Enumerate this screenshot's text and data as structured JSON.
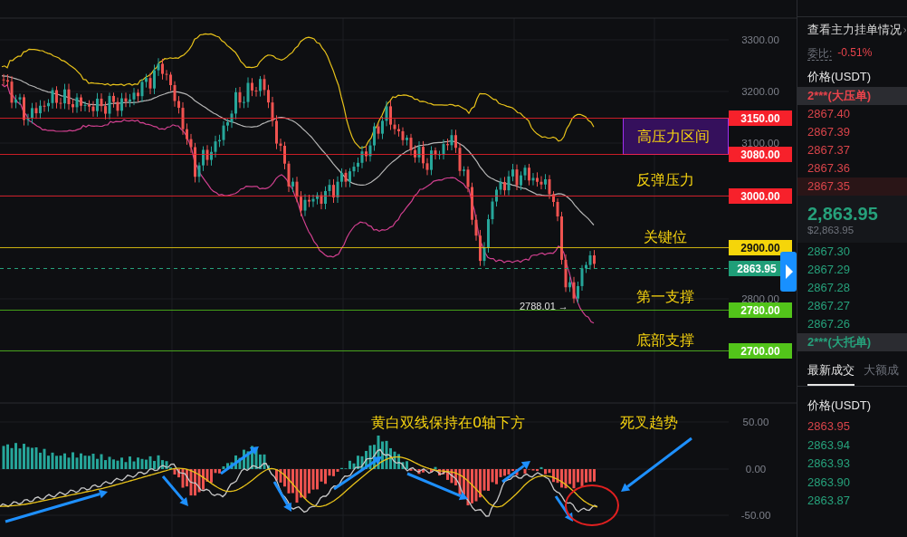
{
  "price_chart": {
    "axis_labels": [
      "3300.00",
      "3200.00",
      "3100.00",
      "2800.00"
    ],
    "level_lines": [
      {
        "price": "3150.00",
        "color": "#f7212b"
      },
      {
        "price": "3080.00",
        "color": "#f7212b"
      },
      {
        "price": "3000.00",
        "color": "#f7212b"
      },
      {
        "price": "2900.00",
        "color": "#f5d50a"
      },
      {
        "price": "2780.00",
        "color": "#52c41a"
      },
      {
        "price": "2700.00",
        "color": "#52c41a"
      }
    ],
    "zone": {
      "label": "高压力区间"
    },
    "annotations": [
      "反弹压力",
      "关键位",
      "第一支撑",
      "底部支撑"
    ],
    "current_price": "2863.95",
    "low_marker": "2788.01 →"
  },
  "macd": {
    "axis_labels": [
      "50.00",
      "0.00",
      "-50.00"
    ],
    "annotations": [
      "黄白双线保持在0轴下方",
      "死叉趋势"
    ]
  },
  "order_book": {
    "link": "查看主力挂单情况",
    "ratio_label": "委比:",
    "ratio_value": "-0.51%",
    "price_header": "价格(USDT)",
    "ask_banner": "2***(大压单)",
    "asks": [
      {
        "price": "2867.40",
        "highlighted": false
      },
      {
        "price": "2867.39",
        "highlighted": false
      },
      {
        "price": "2867.37",
        "highlighted": false
      },
      {
        "price": "2867.36",
        "highlighted": false
      },
      {
        "price": "2867.35",
        "highlighted": true
      }
    ],
    "last_price": "2,863.95",
    "last_price_usd": "$2,863.95",
    "bids": [
      "2867.30",
      "2867.29",
      "2867.28",
      "2867.27",
      "2867.26"
    ],
    "bid_banner": "2***(大托单)"
  },
  "trades": {
    "tabs": [
      {
        "label": "最新成交",
        "selected": true
      },
      {
        "label": "大额成",
        "selected": false
      }
    ],
    "price_header": "价格(USDT)",
    "rows": [
      {
        "price": "2863.95",
        "color": "#d9444a"
      },
      {
        "price": "2863.94",
        "color": "#26a17b"
      },
      {
        "price": "2863.93",
        "color": "#26a17b"
      },
      {
        "price": "2863.90",
        "color": "#26a17b"
      },
      {
        "price": "2863.87",
        "color": "#26a17b"
      }
    ]
  }
}
